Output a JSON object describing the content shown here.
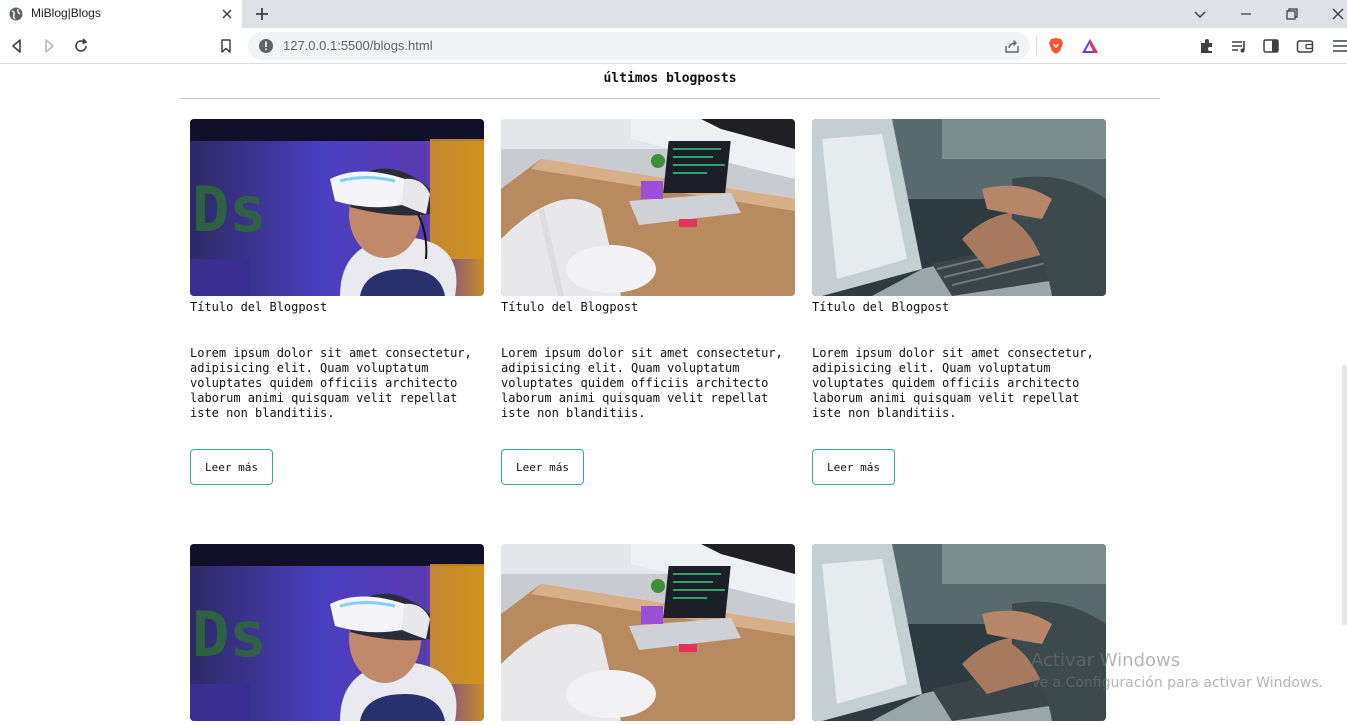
{
  "browser": {
    "tab_title": "MiBlog|Blogs",
    "url": "127.0.0.1:5500/blogs.html"
  },
  "page": {
    "section_title": "últimos blogposts",
    "posts": [
      {
        "image": "vr-headset-photo",
        "title": "Título del Blogpost",
        "text": "Lorem ipsum dolor sit amet consectetur, adipisicing elit. Quam voluptatum voluptates quidem officiis architecto laborum animi quisquam velit repellat iste non blanditiis.",
        "button": "Leer más"
      },
      {
        "image": "laptop-desk-photo",
        "title": "Título del Blogpost",
        "text": "Lorem ipsum dolor sit amet consectetur, adipisicing elit. Quam voluptatum voluptates quidem officiis architecto laborum animi quisquam velit repellat iste non blanditiis.",
        "button": "Leer más"
      },
      {
        "image": "typing-hands-photo",
        "title": "Título del Blogpost",
        "text": "Lorem ipsum dolor sit amet consectetur, adipisicing elit. Quam voluptatum voluptates quidem officiis architecto laborum animi quisquam velit repellat iste non blanditiis.",
        "button": "Leer más"
      },
      {
        "image": "vr-headset-photo"
      },
      {
        "image": "laptop-desk-photo"
      },
      {
        "image": "typing-hands-photo"
      }
    ]
  },
  "watermark": {
    "title": "Activar Windows",
    "subtitle": "Ve a Configuración para activar Windows."
  },
  "colors": {
    "button_border": "#3aa89c",
    "tabbar_bg": "#dee1e6",
    "brave_orange": "#fb542b"
  }
}
